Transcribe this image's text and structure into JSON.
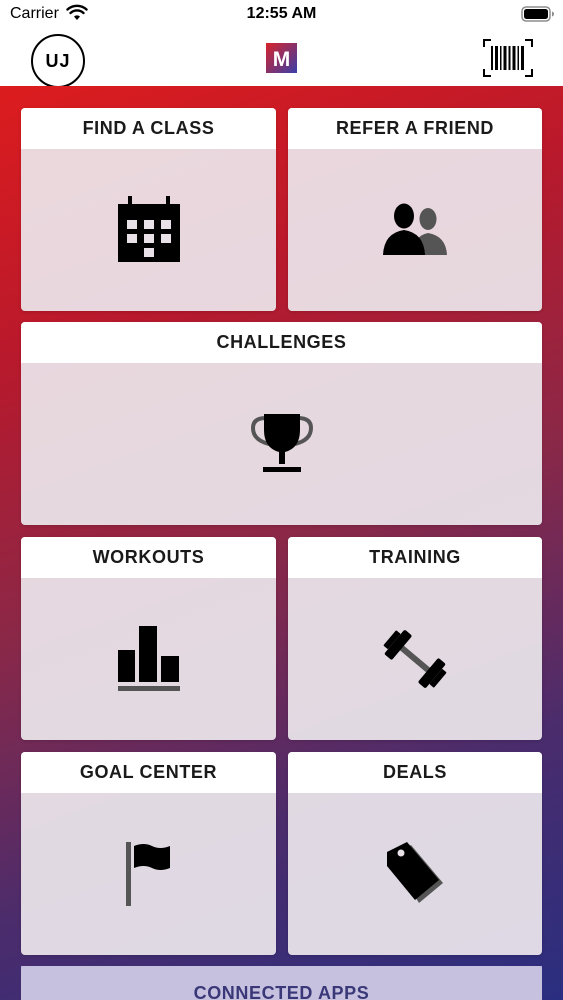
{
  "status_bar": {
    "carrier": "Carrier",
    "time": "12:55 AM",
    "wifi_icon": "wifi-icon",
    "battery_icon": "battery-icon"
  },
  "nav": {
    "avatar_initials": "UJ",
    "logo_icon": "app-logo-icon",
    "logo_letter": "M",
    "barcode_icon": "barcode-icon"
  },
  "tiles": {
    "find_class": {
      "label": "FIND A CLASS",
      "icon": "calendar-icon"
    },
    "refer_friend": {
      "label": "REFER A FRIEND",
      "icon": "people-icon"
    },
    "challenges": {
      "label": "CHALLENGES",
      "icon": "trophy-icon"
    },
    "workouts": {
      "label": "WORKOUTS",
      "icon": "bar-chart-icon"
    },
    "training": {
      "label": "TRAINING",
      "icon": "dumbbell-icon"
    },
    "goal_center": {
      "label": "GOAL CENTER",
      "icon": "flag-icon"
    },
    "deals": {
      "label": "DEALS",
      "icon": "tag-icon"
    },
    "connected_apps": {
      "label": "CONNECTED APPS"
    }
  },
  "colors": {
    "gradient_top": "#dc1c1e",
    "gradient_bottom": "#2a2e80",
    "logo_red": "#d8232a",
    "logo_blue": "#3a3fa8"
  }
}
